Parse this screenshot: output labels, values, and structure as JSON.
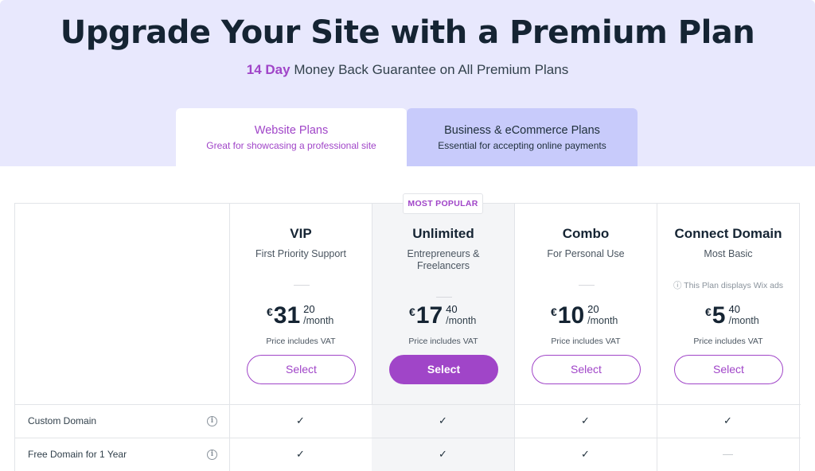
{
  "hero": {
    "title": "Upgrade Your Site with a Premium Plan",
    "guarantee_highlight": "14 Day",
    "guarantee_rest": " Money Back Guarantee on All Premium Plans"
  },
  "tabs": [
    {
      "title": "Website Plans",
      "subtitle": "Great for showcasing a professional site",
      "active": true
    },
    {
      "title": "Business & eCommerce Plans",
      "subtitle": "Essential for accepting online payments",
      "active": false
    }
  ],
  "badge": "MOST POPULAR",
  "plans": [
    {
      "name": "VIP",
      "desc": "First Priority Support",
      "currency": "€",
      "amount": "31",
      "cents": "20",
      "period": "/month",
      "vat": "Price includes VAT",
      "button": "Select",
      "note": ""
    },
    {
      "name": "Unlimited",
      "desc": "Entrepreneurs & Freelancers",
      "currency": "€",
      "amount": "17",
      "cents": "40",
      "period": "/month",
      "vat": "Price includes VAT",
      "button": "Select",
      "note": ""
    },
    {
      "name": "Combo",
      "desc": "For Personal Use",
      "currency": "€",
      "amount": "10",
      "cents": "20",
      "period": "/month",
      "vat": "Price includes VAT",
      "button": "Select",
      "note": ""
    },
    {
      "name": "Connect Domain",
      "desc": "Most Basic",
      "currency": "€",
      "amount": "5",
      "cents": "40",
      "period": "/month",
      "vat": "Price includes VAT",
      "button": "Select",
      "note": "ⓘ This Plan displays Wix ads"
    }
  ],
  "features": [
    {
      "label": "Custom Domain",
      "values": [
        "✓",
        "✓",
        "✓",
        "✓"
      ]
    },
    {
      "label": "Free Domain for 1 Year",
      "values": [
        "✓",
        "✓",
        "✓",
        "—"
      ]
    }
  ],
  "colors": {
    "accent": "#a045c8",
    "hero_bg": "#e8e8fd",
    "inactive_tab": "#c8cbfb",
    "popular_bg": "#f4f5f7"
  }
}
